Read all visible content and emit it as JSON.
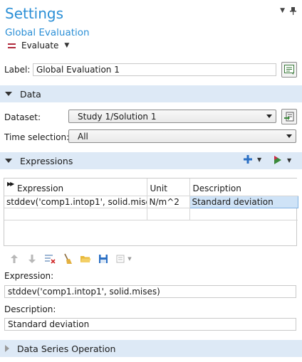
{
  "header": {
    "title": "Settings",
    "subtitle": "Global Evaluation",
    "evaluate_label": "Evaluate"
  },
  "label_field": {
    "caption": "Label:",
    "value": "Global Evaluation 1"
  },
  "data_section": {
    "title": "Data",
    "dataset_caption": "Dataset:",
    "dataset_value": "Study 1/Solution 1",
    "time_caption": "Time selection:",
    "time_value": "All"
  },
  "expressions_section": {
    "title": "Expressions",
    "columns": [
      "Expression",
      "Unit",
      "Description"
    ],
    "rows": [
      {
        "expression": "stddev('comp1.intop1', solid.mises)",
        "unit": "N/m^2",
        "description": "Standard deviation"
      }
    ],
    "expression_caption": "Expression:",
    "expression_value": "stddev('comp1.intop1', solid.mises)",
    "description_caption": "Description:",
    "description_value": "Standard deviation"
  },
  "series_section": {
    "title": "Data Series Operation"
  },
  "colors": {
    "accent": "#2b8fd6",
    "section_bg": "#dde9f6",
    "selection": "#cfe3f7"
  }
}
